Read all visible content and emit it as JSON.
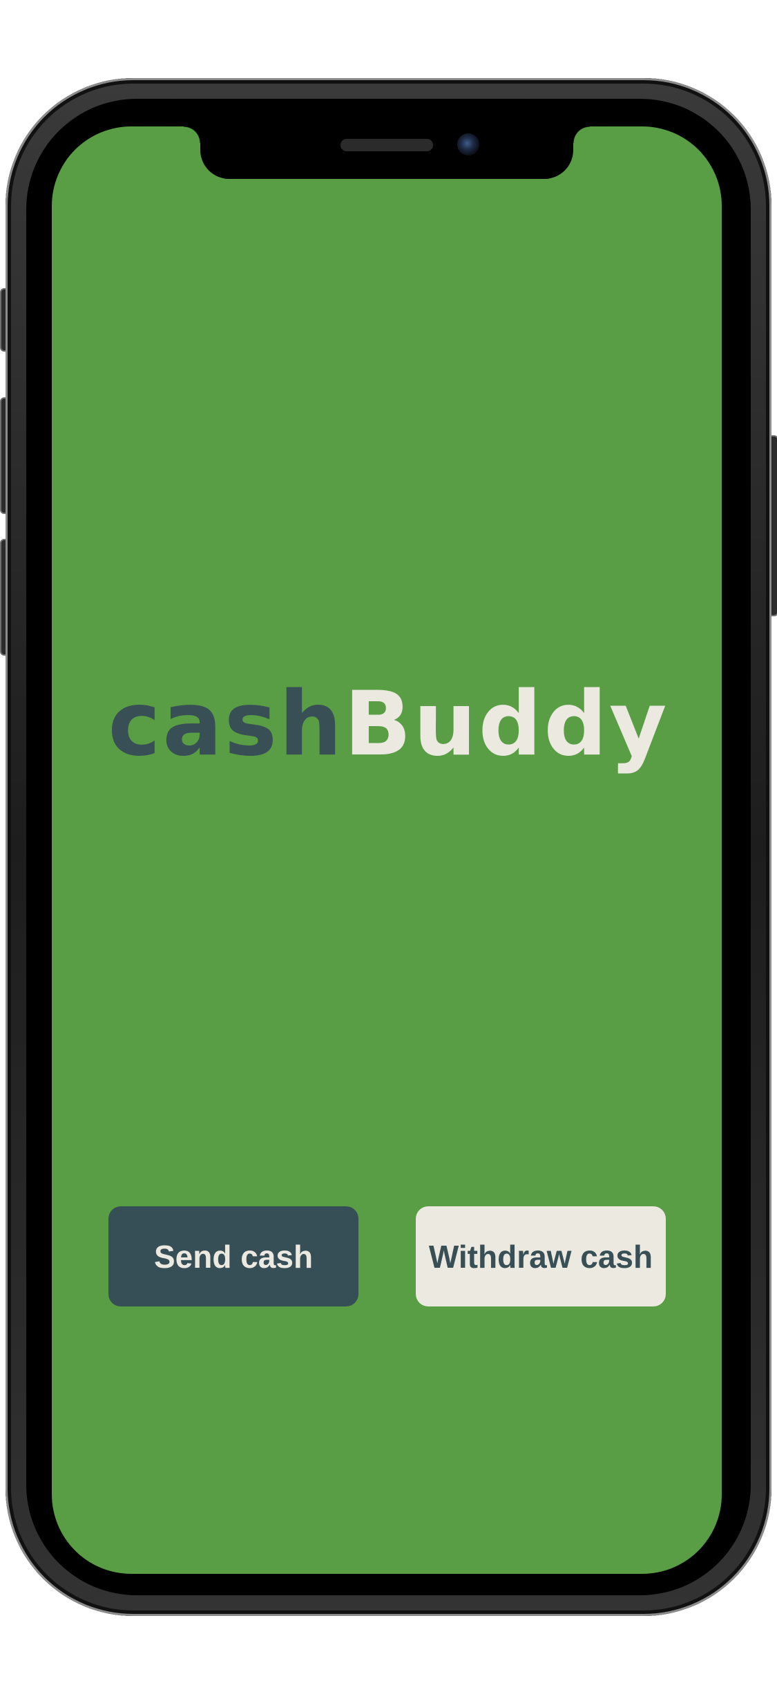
{
  "app": {
    "logo_part_1": "cash",
    "logo_part_2": "Buddy"
  },
  "actions": {
    "send_label": "Send cash",
    "withdraw_label": "Withdraw cash"
  },
  "colors": {
    "screen_background": "#599d45",
    "logo_dark": "#384f56",
    "logo_light": "#ece9e1",
    "send_button_bg": "#364e55",
    "withdraw_button_bg": "#ece9e1"
  },
  "icons": {
    "speaker": "earpiece-speaker-icon",
    "camera": "front-camera-icon"
  }
}
